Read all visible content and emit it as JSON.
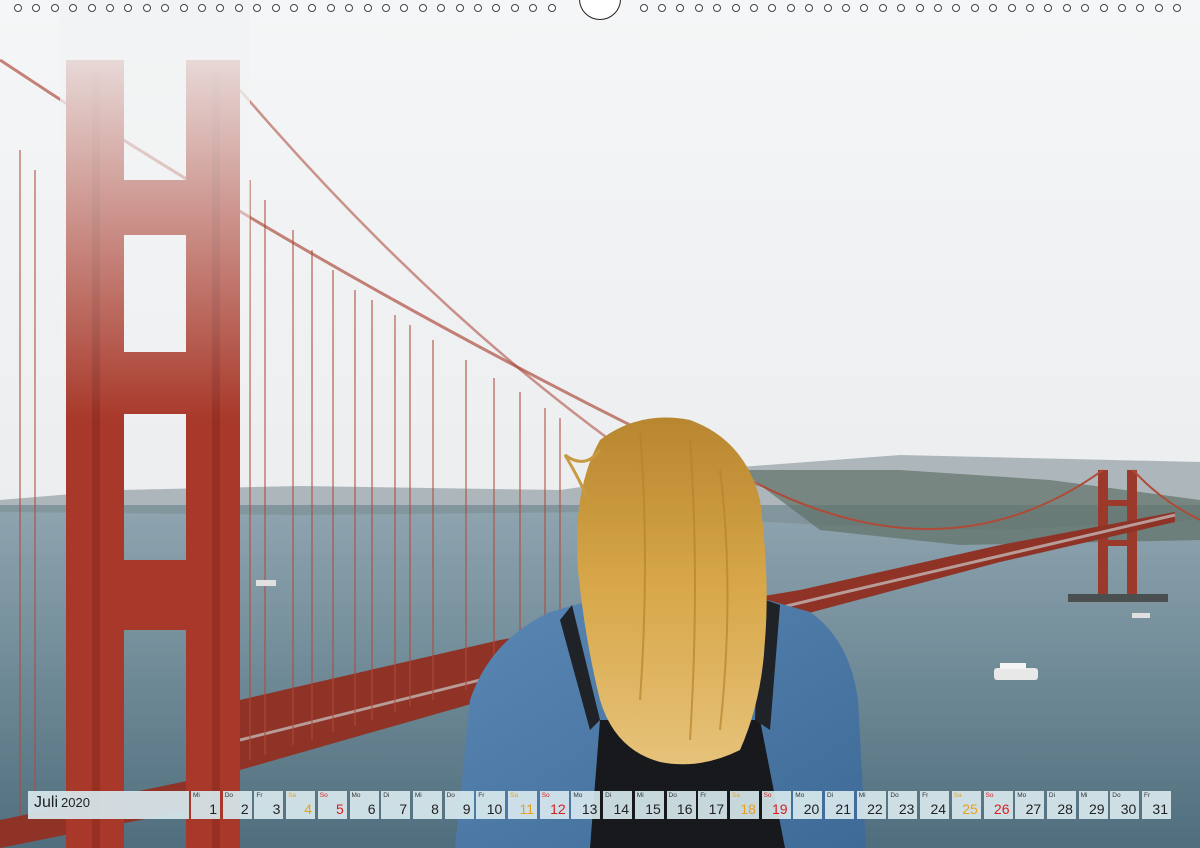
{
  "calendar": {
    "month": "Juli",
    "year": "2020",
    "colors": {
      "saturday": "#e8a11e",
      "sunday": "#d81f1f",
      "cell": "#d7e8ee"
    },
    "days": [
      {
        "wd": "Mi",
        "n": "1"
      },
      {
        "wd": "Do",
        "n": "2"
      },
      {
        "wd": "Fr",
        "n": "3"
      },
      {
        "wd": "Sa",
        "n": "4"
      },
      {
        "wd": "So",
        "n": "5"
      },
      {
        "wd": "Mo",
        "n": "6"
      },
      {
        "wd": "Di",
        "n": "7"
      },
      {
        "wd": "Mi",
        "n": "8"
      },
      {
        "wd": "Do",
        "n": "9"
      },
      {
        "wd": "Fr",
        "n": "10"
      },
      {
        "wd": "Sa",
        "n": "11"
      },
      {
        "wd": "So",
        "n": "12"
      },
      {
        "wd": "Mo",
        "n": "13"
      },
      {
        "wd": "Di",
        "n": "14"
      },
      {
        "wd": "Mi",
        "n": "15"
      },
      {
        "wd": "Do",
        "n": "16"
      },
      {
        "wd": "Fr",
        "n": "17"
      },
      {
        "wd": "Sa",
        "n": "18"
      },
      {
        "wd": "So",
        "n": "19"
      },
      {
        "wd": "Mo",
        "n": "20"
      },
      {
        "wd": "Di",
        "n": "21"
      },
      {
        "wd": "Mi",
        "n": "22"
      },
      {
        "wd": "Do",
        "n": "23"
      },
      {
        "wd": "Fr",
        "n": "24"
      },
      {
        "wd": "Sa",
        "n": "25"
      },
      {
        "wd": "So",
        "n": "26"
      },
      {
        "wd": "Mo",
        "n": "27"
      },
      {
        "wd": "Di",
        "n": "28"
      },
      {
        "wd": "Mi",
        "n": "29"
      },
      {
        "wd": "Do",
        "n": "30"
      },
      {
        "wd": "Fr",
        "n": "31"
      }
    ]
  }
}
